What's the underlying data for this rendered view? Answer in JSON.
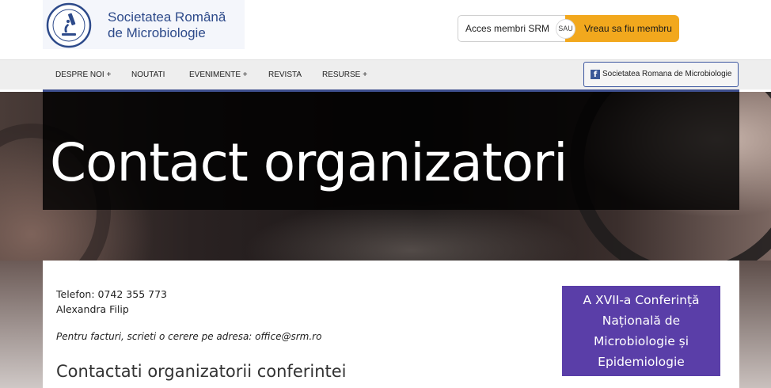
{
  "logo": {
    "line1": "Societatea Română",
    "line2": "de Microbiologie",
    "emblem_icon": "microscope-emblem-icon"
  },
  "member": {
    "access_label": "Acces membri SRM",
    "or_label": "SAU",
    "join_label": "Vreau sa fiu membru",
    "join_color": "#f2a81d"
  },
  "nav": {
    "items": [
      {
        "label": "DESPRE NOI +"
      },
      {
        "label": "NOUTATI"
      },
      {
        "label": "EVENIMENTE +"
      },
      {
        "label": "REVISTA"
      },
      {
        "label": "RESURSE +"
      }
    ],
    "facebook_label": "Societatea Romana de Microbiologie",
    "facebook_icon": "facebook-icon",
    "accent_color": "#3e4f8e"
  },
  "hero": {
    "title": "Contact organizatori"
  },
  "content": {
    "phone": "Telefon: 0742 355 773",
    "contact_name": "Alexandra Filip",
    "invoice_note": "Pentru facturi, scrieti o cerere pe adresa: office@srm.ro",
    "section_heading": "Contactati organizatorii conferintei"
  },
  "sidebar": {
    "conference_lines": [
      "A XVII-a Conferință",
      "Națională de",
      "Microbiologie și",
      "Epidemiologie"
    ],
    "box_color": "#5a3ea8"
  }
}
